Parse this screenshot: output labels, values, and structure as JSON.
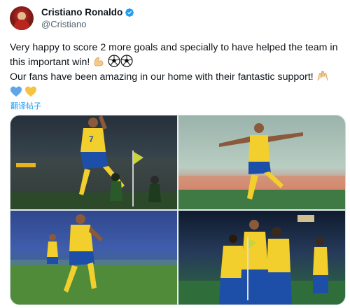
{
  "author": {
    "display_name": "Cristiano Ronaldo",
    "handle": "@Cristiano",
    "verified": true,
    "avatar_icon": "profile-avatar"
  },
  "tweet": {
    "line1": "Very happy to score 2 more goals and specially to have helped the team in this important win! ",
    "line1_emojis": [
      "flexed-biceps-icon",
      "soccer-ball-icon",
      "soccer-ball-icon"
    ],
    "line2": "Our fans have been amazing in our home with their fantastic support! ",
    "line2_emojis": [
      "raising-hands-icon"
    ],
    "line3_emojis": [
      "blue-heart-icon",
      "yellow-heart-icon"
    ]
  },
  "translate_label": "翻译帖子",
  "media": {
    "photos": [
      "photo-celebration-jump",
      "photo-arms-spread",
      "photo-goal-run",
      "photo-team-celebration"
    ]
  },
  "colors": {
    "accent": "#1d9bf0",
    "text": "#0f1419",
    "secondary": "#536471",
    "jersey_yellow": "#f2cf2c",
    "jersey_blue": "#1d4fa8"
  }
}
